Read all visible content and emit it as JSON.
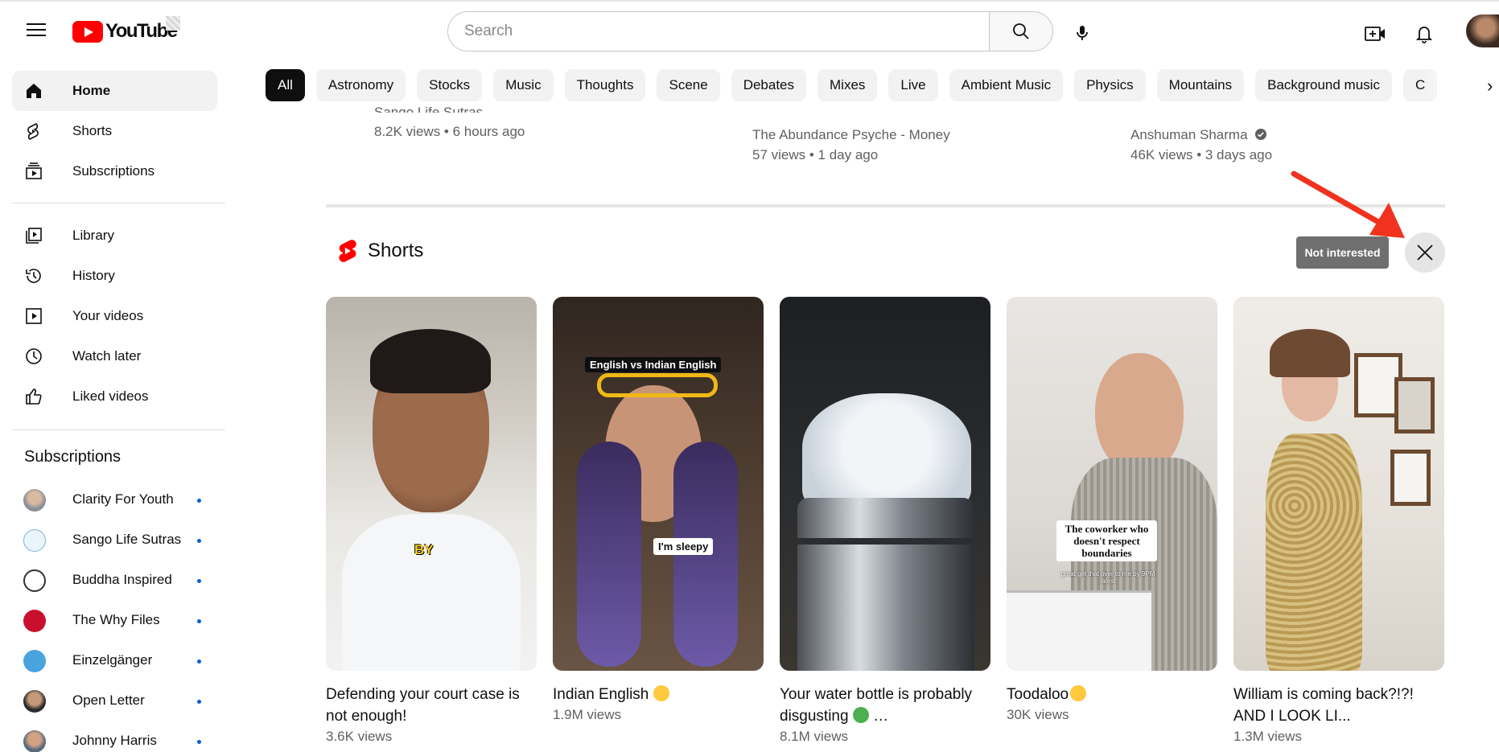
{
  "header": {
    "logo_text": "YouTube",
    "search_placeholder": "Search"
  },
  "sidebar": {
    "main": [
      {
        "label": "Home",
        "icon": "home-icon",
        "active": true
      },
      {
        "label": "Shorts",
        "icon": "shorts-icon"
      },
      {
        "label": "Subscriptions",
        "icon": "subscriptions-icon"
      }
    ],
    "library": [
      {
        "label": "Library",
        "icon": "library-icon"
      },
      {
        "label": "History",
        "icon": "history-icon"
      },
      {
        "label": "Your videos",
        "icon": "your-videos-icon"
      },
      {
        "label": "Watch later",
        "icon": "watch-later-icon"
      },
      {
        "label": "Liked videos",
        "icon": "liked-videos-icon"
      }
    ],
    "subscriptions_title": "Subscriptions",
    "subscriptions": [
      {
        "label": "Clarity For Youth"
      },
      {
        "label": "Sango Life Sutras"
      },
      {
        "label": "Buddha Inspired"
      },
      {
        "label": "The Why Files"
      },
      {
        "label": "Einzelgänger"
      },
      {
        "label": "Open Letter"
      },
      {
        "label": "Johnny Harris"
      }
    ]
  },
  "chips": [
    "All",
    "Astronomy",
    "Stocks",
    "Music",
    "Thoughts",
    "Scene",
    "Debates",
    "Mixes",
    "Live",
    "Ambient Music",
    "Physics",
    "Mountains",
    "Background music",
    "C"
  ],
  "previous_row": [
    {
      "channel": "Sango Life Sutras",
      "meta": "8.2K views • 6 hours ago"
    },
    {
      "channel": "The Abundance Psyche - Money",
      "meta": "57 views • 1 day ago"
    },
    {
      "channel": "Anshuman Sharma",
      "meta": "46K views • 3 days ago",
      "verified": true
    }
  ],
  "shorts_shelf": {
    "title": "Shorts",
    "tooltip": "Not interested",
    "items": [
      {
        "title": "Defending your court case is not enough!",
        "views": "3.6K views",
        "caption": "BY"
      },
      {
        "title": "Indian English",
        "views": "1.9M views",
        "caption_top": "English vs Indian English",
        "caption_mid": "I'm sleepy"
      },
      {
        "title": "Your water bottle is probably disgusting",
        "views": "8.1M views"
      },
      {
        "title": "Toodaloo",
        "views": "30K views",
        "caption_1": "The coworker who",
        "caption_2": "doesn't respect",
        "caption_3": "boundaries",
        "caption_small": "great get that over to me by 9PM latest"
      },
      {
        "title": "William is coming back?!?! AND I LOOK LI...",
        "views": "1.3M views"
      }
    ]
  },
  "colors": {
    "brand_red": "#ff0000",
    "annotation_arrow": "#f0321e",
    "chip_active_bg": "#0f0f0f",
    "subscription_dot": "#065fd4"
  }
}
